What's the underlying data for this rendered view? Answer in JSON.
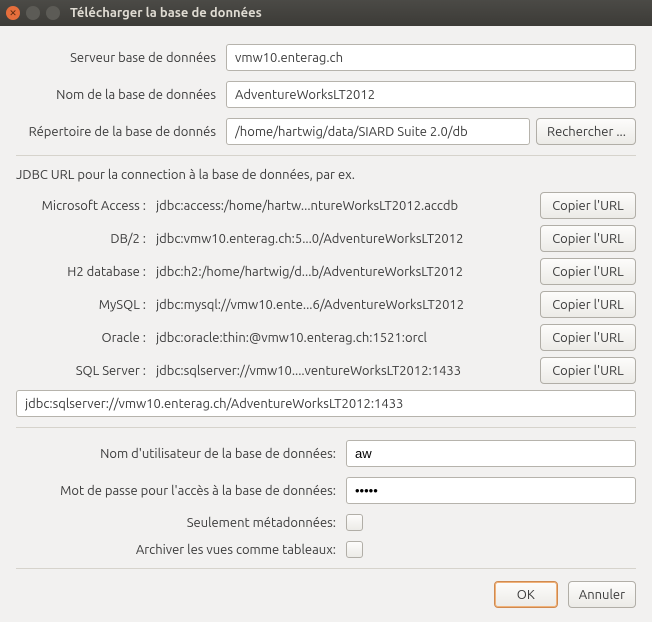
{
  "window": {
    "title": "Télécharger la base de données"
  },
  "form": {
    "server_label": "Serveur base de données",
    "server_value": "vmw10.enterag.ch",
    "dbname_label": "Nom de la base de données",
    "dbname_value": "AdventureWorksLT2012",
    "dir_label": "Répertoire de la base de donnés",
    "dir_value": "/home/hartwig/data/SIARD Suite 2.0/db",
    "browse_label": "Rechercher ..."
  },
  "jdbc": {
    "heading": "JDBC URL pour la connection à la base de données, par ex.",
    "copy_label": "Copier l'URL",
    "rows": [
      {
        "label": "Microsoft Access :",
        "value": "jdbc:access:/home/hartw...ntureWorksLT2012.accdb"
      },
      {
        "label": "DB/2 :",
        "value": "jdbc:vmw10.enterag.ch:5...0/AdventureWorksLT2012"
      },
      {
        "label": "H2 database :",
        "value": "jdbc:h2:/home/hartwig/d...b/AdventureWorksLT2012"
      },
      {
        "label": "MySQL :",
        "value": "jdbc:mysql://vmw10.ente...6/AdventureWorksLT2012"
      },
      {
        "label": "Oracle :",
        "value": "jdbc:oracle:thin:@vmw10.enterag.ch:1521:orcl"
      },
      {
        "label": "SQL Server :",
        "value": "jdbc:sqlserver://vmw10....ventureWorksLT2012:1433"
      }
    ],
    "url_value": "jdbc:sqlserver://vmw10.enterag.ch/AdventureWorksLT2012:1433"
  },
  "auth": {
    "user_label": "Nom d'utilisateur de la base de données:",
    "user_value": "aw",
    "pass_label": "Mot de passe pour l'accès à la base de données:",
    "pass_value": "•••••",
    "meta_label": "Seulement métadonnées:",
    "views_label": "Archiver les vues comme tableaux:"
  },
  "actions": {
    "ok_label": "OK",
    "cancel_label": "Annuler"
  }
}
